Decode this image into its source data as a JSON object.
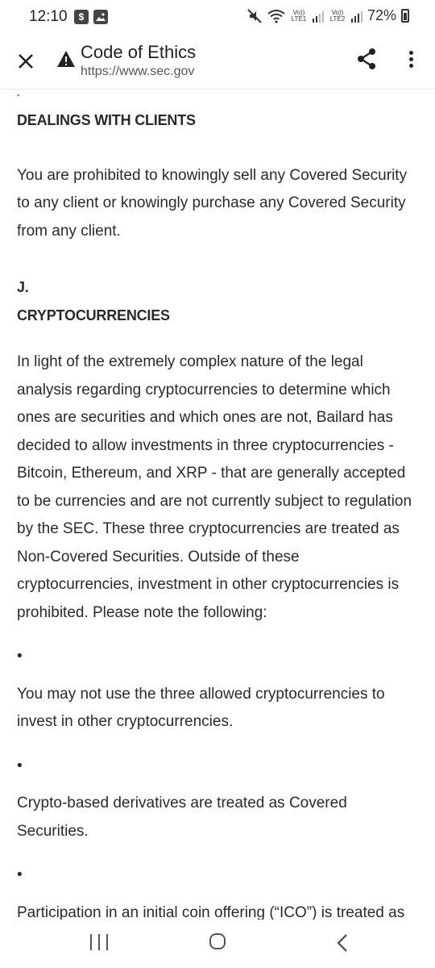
{
  "status_bar": {
    "time": "12:10",
    "left_icons": [
      "shopping-bag-icon",
      "image-icon"
    ],
    "right_icons": [
      "mute-icon",
      "wifi-icon",
      "signal-lte1-icon",
      "signal-lte2-icon"
    ],
    "lte1_label": "Vo)) LTE1",
    "lte2_label": "Vo)) LTE2",
    "battery": "72%"
  },
  "toolbar": {
    "title": "Code of Ethics",
    "url": "https://www.sec.gov"
  },
  "content": {
    "top_fragment": "\"",
    "section_i_heading": "DEALINGS WITH CLIENTS",
    "section_i_body": "You are prohibited to knowingly sell any Covered Security to any client or knowingly purchase any Covered Security from any client.",
    "section_j_letter": "J.",
    "section_j_heading": "CRYPTOCURRENCIES",
    "section_j_body": "In light of the extremely complex nature of the legal analysis regarding cryptocurrencies to determine which ones are securities and which ones are not, Bailard has decided to allow investments in three cryptocurrencies - Bitcoin, Ethereum, and XRP - that are generally accepted to be currencies and are not currently subject to regulation by the SEC. These three cryptocurrencies are treated as Non-Covered Securities. Outside of these cryptocurrencies, investment in other cryptocurrencies is prohibited. Please note the following:",
    "bullets": [
      {
        "marker": "•",
        "text": "You may not use the three allowed cryptocurrencies to invest in other cryptocurrencies."
      },
      {
        "marker": "•",
        "text": "Crypto-based derivatives are treated as Covered Securities."
      },
      {
        "marker": "•",
        "text": "Participation in an initial coin offering (“ICO”) is treated as participation in IPOs and Private Placements. Participation in ICOs, IPOs, and Private Placements"
      }
    ]
  }
}
